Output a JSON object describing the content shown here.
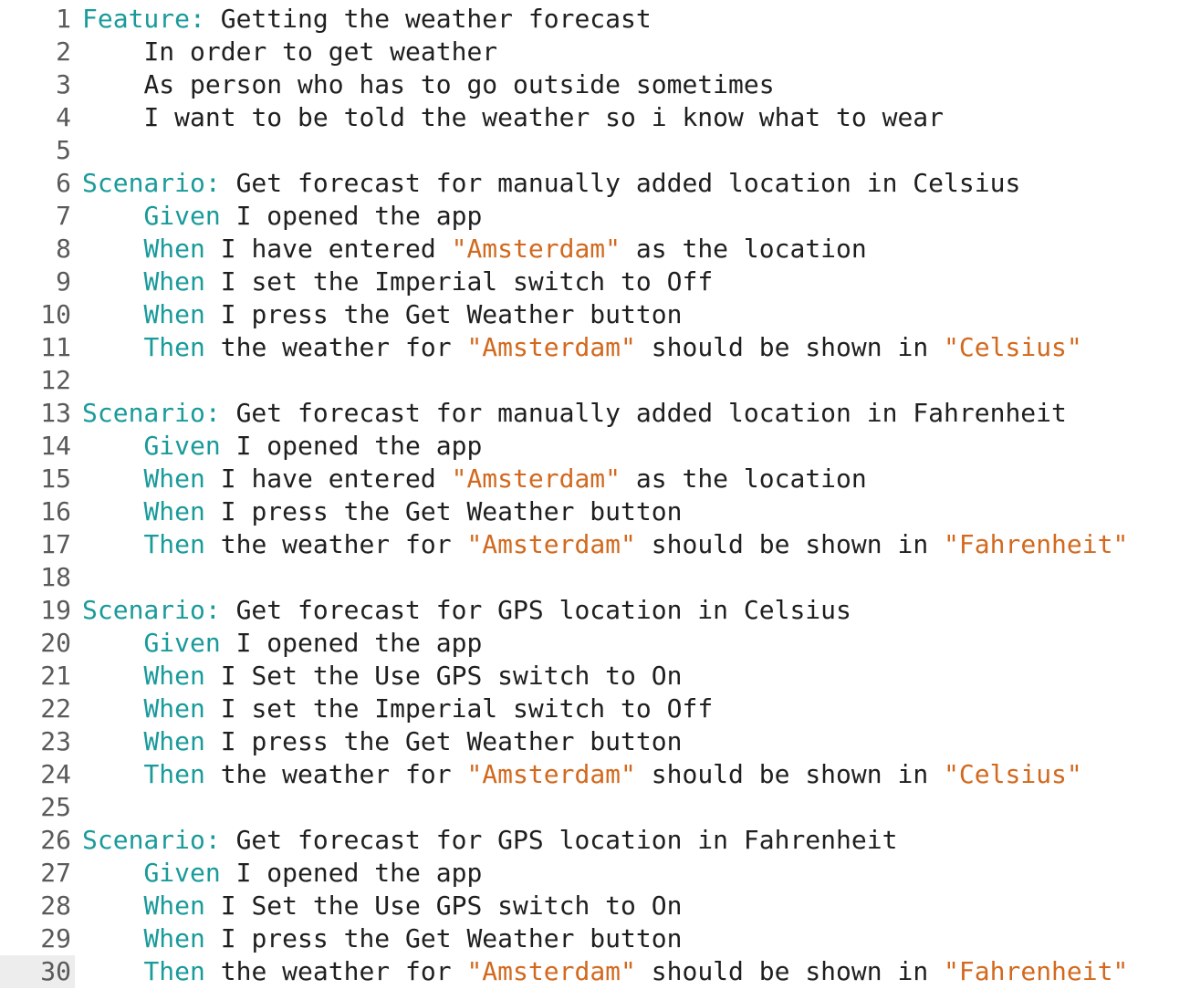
{
  "editor": {
    "current_line": 30,
    "colors": {
      "keyword": "#1a9a9a",
      "string": "#d2691e",
      "text": "#1f1f1f",
      "line_number": "#5a5a5a",
      "current_line_gutter": "#ededed"
    },
    "lines": [
      {
        "n": "1",
        "indent": 0,
        "parts": [
          [
            "kw",
            "Feature:"
          ],
          [
            "t",
            " Getting the weather forecast"
          ]
        ]
      },
      {
        "n": "2",
        "indent": 1,
        "parts": [
          [
            "t",
            "In order to get weather"
          ]
        ]
      },
      {
        "n": "3",
        "indent": 1,
        "parts": [
          [
            "t",
            "As person who has to go outside sometimes"
          ]
        ]
      },
      {
        "n": "4",
        "indent": 1,
        "parts": [
          [
            "t",
            "I want to be told the weather so i know what to wear"
          ]
        ]
      },
      {
        "n": "5",
        "indent": 0,
        "parts": []
      },
      {
        "n": "6",
        "indent": 0,
        "parts": [
          [
            "kw",
            "Scenario:"
          ],
          [
            "t",
            " Get forecast for manually added location in Celsius"
          ]
        ]
      },
      {
        "n": "7",
        "indent": 1,
        "parts": [
          [
            "kw",
            "Given"
          ],
          [
            "t",
            " I opened the app"
          ]
        ]
      },
      {
        "n": "8",
        "indent": 1,
        "parts": [
          [
            "kw",
            "When"
          ],
          [
            "t",
            " I have entered "
          ],
          [
            "str",
            "\"Amsterdam\""
          ],
          [
            "t",
            " as the location"
          ]
        ]
      },
      {
        "n": "9",
        "indent": 1,
        "parts": [
          [
            "kw",
            "When"
          ],
          [
            "t",
            " I set the Imperial switch to Off"
          ]
        ]
      },
      {
        "n": "10",
        "indent": 1,
        "parts": [
          [
            "kw",
            "When"
          ],
          [
            "t",
            " I press the Get Weather button"
          ]
        ]
      },
      {
        "n": "11",
        "indent": 1,
        "parts": [
          [
            "kw",
            "Then"
          ],
          [
            "t",
            " the weather for "
          ],
          [
            "str",
            "\"Amsterdam\""
          ],
          [
            "t",
            " should be shown in "
          ],
          [
            "str",
            "\"Celsius\""
          ]
        ]
      },
      {
        "n": "12",
        "indent": 0,
        "parts": []
      },
      {
        "n": "13",
        "indent": 0,
        "parts": [
          [
            "kw",
            "Scenario:"
          ],
          [
            "t",
            " Get forecast for manually added location in Fahrenheit"
          ]
        ]
      },
      {
        "n": "14",
        "indent": 1,
        "parts": [
          [
            "kw",
            "Given"
          ],
          [
            "t",
            " I opened the app"
          ]
        ]
      },
      {
        "n": "15",
        "indent": 1,
        "parts": [
          [
            "kw",
            "When"
          ],
          [
            "t",
            " I have entered "
          ],
          [
            "str",
            "\"Amsterdam\""
          ],
          [
            "t",
            " as the location"
          ]
        ]
      },
      {
        "n": "16",
        "indent": 1,
        "parts": [
          [
            "kw",
            "When"
          ],
          [
            "t",
            " I press the Get Weather button"
          ]
        ]
      },
      {
        "n": "17",
        "indent": 1,
        "parts": [
          [
            "kw",
            "Then"
          ],
          [
            "t",
            " the weather for "
          ],
          [
            "str",
            "\"Amsterdam\""
          ],
          [
            "t",
            " should be shown in "
          ],
          [
            "str",
            "\"Fahrenheit\""
          ]
        ]
      },
      {
        "n": "18",
        "indent": 0,
        "parts": []
      },
      {
        "n": "19",
        "indent": 0,
        "parts": [
          [
            "kw",
            "Scenario:"
          ],
          [
            "t",
            " Get forecast for GPS location in Celsius"
          ]
        ]
      },
      {
        "n": "20",
        "indent": 1,
        "parts": [
          [
            "kw",
            "Given"
          ],
          [
            "t",
            " I opened the app"
          ]
        ]
      },
      {
        "n": "21",
        "indent": 1,
        "parts": [
          [
            "kw",
            "When"
          ],
          [
            "t",
            " I Set the Use GPS switch to On"
          ]
        ]
      },
      {
        "n": "22",
        "indent": 1,
        "parts": [
          [
            "kw",
            "When"
          ],
          [
            "t",
            " I set the Imperial switch to Off"
          ]
        ]
      },
      {
        "n": "23",
        "indent": 1,
        "parts": [
          [
            "kw",
            "When"
          ],
          [
            "t",
            " I press the Get Weather button"
          ]
        ]
      },
      {
        "n": "24",
        "indent": 1,
        "parts": [
          [
            "kw",
            "Then"
          ],
          [
            "t",
            " the weather for "
          ],
          [
            "str",
            "\"Amsterdam\""
          ],
          [
            "t",
            " should be shown in "
          ],
          [
            "str",
            "\"Celsius\""
          ]
        ]
      },
      {
        "n": "25",
        "indent": 0,
        "parts": []
      },
      {
        "n": "26",
        "indent": 0,
        "parts": [
          [
            "kw",
            "Scenario:"
          ],
          [
            "t",
            " Get forecast for GPS location in Fahrenheit"
          ]
        ]
      },
      {
        "n": "27",
        "indent": 1,
        "parts": [
          [
            "kw",
            "Given"
          ],
          [
            "t",
            " I opened the app"
          ]
        ]
      },
      {
        "n": "28",
        "indent": 1,
        "parts": [
          [
            "kw",
            "When"
          ],
          [
            "t",
            " I Set the Use GPS switch to On"
          ]
        ]
      },
      {
        "n": "29",
        "indent": 1,
        "parts": [
          [
            "kw",
            "When"
          ],
          [
            "t",
            " I press the Get Weather button"
          ]
        ]
      },
      {
        "n": "30",
        "indent": 1,
        "parts": [
          [
            "kw",
            "Then"
          ],
          [
            "t",
            " the weather for "
          ],
          [
            "str",
            "\"Amsterdam\""
          ],
          [
            "t",
            " should be shown in "
          ],
          [
            "str",
            "\"Fahrenheit\""
          ]
        ]
      }
    ]
  }
}
